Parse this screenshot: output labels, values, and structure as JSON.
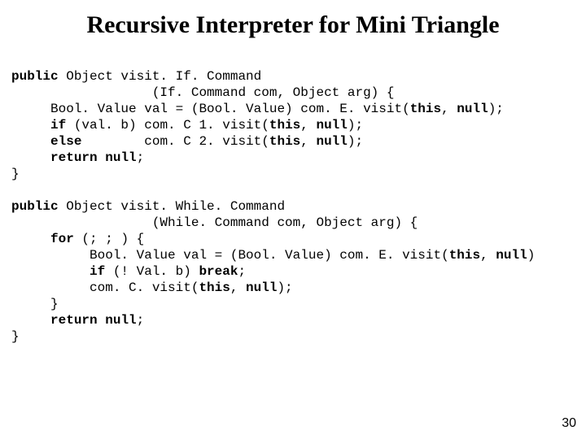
{
  "title": "Recursive Interpreter for Mini Triangle",
  "kw": {
    "public": "public",
    "if": "if",
    "else": "else",
    "return": "return",
    "for": "for",
    "this": "this",
    "null": "null",
    "break": "break"
  },
  "block1": {
    "sig_a": " Object visit. If. Command",
    "sig_b": "                  (If. Command com, Object arg) {",
    "l1_a": "     Bool. Value val = (Bool. Value) com. E. visit(",
    "l1_b": ", ",
    "l1_c": ");",
    "l2_a": "     ",
    "l2_b": " (val. b) com. C 1. visit(",
    "l2_c": ", ",
    "l2_d": ");",
    "l3_a": "     ",
    "l3_b": "        com. C 2. visit(",
    "l3_c": ", ",
    "l3_d": ");",
    "l4_a": "     ",
    "l4_b": " ",
    "l4_c": ";",
    "close": "}"
  },
  "block2": {
    "sig_a": " Object visit. While. Command",
    "sig_b": "                  (While. Command com, Object arg) {",
    "l1_a": "     ",
    "l1_b": " (; ; ) {",
    "l2_a": "          Bool. Value val = (Bool. Value) com. E. visit(",
    "l2_b": ", ",
    "l2_c": ")",
    "l3_a": "          ",
    "l3_b": " (! Val. b) ",
    "l3_c": ";",
    "l4_a": "          com. C. visit(",
    "l4_b": ", ",
    "l4_c": ");",
    "l5": "     }",
    "l6_a": "     ",
    "l6_b": " ",
    "l6_c": ";",
    "close": "}"
  },
  "pageNumber": "30"
}
